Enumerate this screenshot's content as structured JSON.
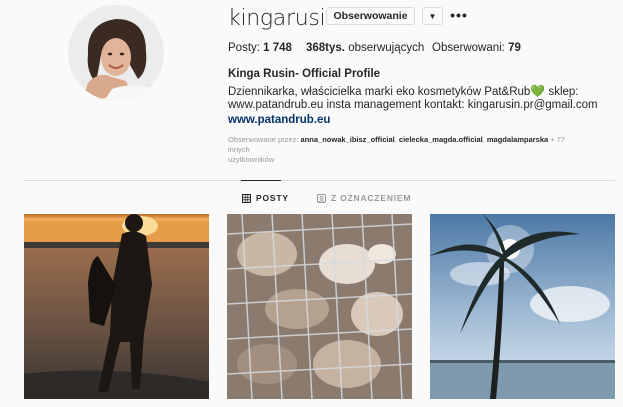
{
  "profile": {
    "username": "kingarusin",
    "follow_label": "Obserwowanie",
    "dropdown_icon": "chevron-down-icon",
    "more_icon": "more-options-icon"
  },
  "stats": {
    "posts_label": "Posty:",
    "posts_value": "1 748",
    "followers_value": "368tys.",
    "followers_label": "obserwujących",
    "following_label": "Obserwowani:",
    "following_value": "79"
  },
  "bio": {
    "name": "Kinga Rusin- Official Profile",
    "line1_a": "Dziennikarka, właścicielka marki eko kosmetyków Pat&Rub",
    "heart": "💚",
    "line1_b": " sklep:",
    "line2": "www.patandrub.eu insta management kontakt: kingarusin.pr@gmail.com",
    "link": "www.patandrub.eu"
  },
  "followed_by": {
    "prefix": "Obserwowane przez:",
    "users": [
      "anna_nowak_ibisz_official",
      "cielecka_magda.official",
      "magdalamparska"
    ],
    "sep": ", ",
    "suffix": " + 77 innych",
    "suffix2": "użytkowników"
  },
  "tabs": [
    {
      "label": "POSTY",
      "icon": "grid-icon",
      "active": true
    },
    {
      "label": "Z OZNACZENIEM",
      "icon": "tagged-icon",
      "active": false
    }
  ],
  "posts": [
    {
      "description_icon": "sunset-silhouette-photo"
    },
    {
      "description_icon": "caged-animals-photo"
    },
    {
      "description_icon": "palm-tree-sun-photo"
    }
  ],
  "colors": {
    "text": "#262626",
    "muted": "#999999",
    "link": "#003569",
    "border": "#dbdbdb",
    "background": "#fafafa"
  }
}
